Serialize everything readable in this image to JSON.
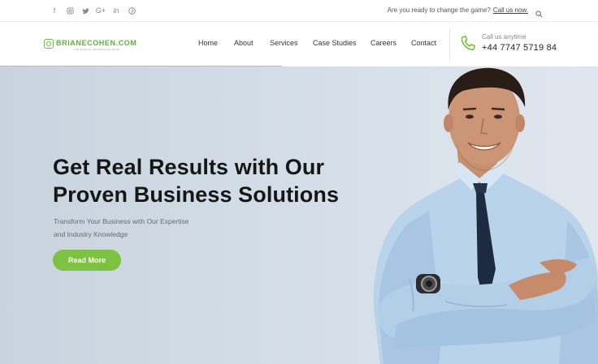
{
  "topbar": {
    "social_icons": [
      "facebook-icon",
      "instagram-icon",
      "twitter-icon",
      "google-plus-icon",
      "linkedin-icon",
      "pinterest-icon"
    ],
    "social_glyphs": [
      "f",
      "",
      "",
      "G+",
      "in",
      ""
    ],
    "promo_text": "Are you ready to change the game?",
    "promo_link": "Call us now."
  },
  "header": {
    "logo_name": "BRIANECOHEN.COM",
    "logo_tagline": "THE DIGITAL MARKETING TEAM",
    "nav": [
      "Home",
      "About",
      "Services",
      "Case Studies",
      "Careers",
      "Contact"
    ],
    "call_label": "Call us anytime",
    "call_number": "+44 7747 5719 84"
  },
  "hero": {
    "title_line1": "Get Real Results with Our",
    "title_line2": "Proven Business Solutions",
    "subtitle_line1": "Transform Your Business with Our Expertise",
    "subtitle_line2": "and Industry Knowledge",
    "cta_label": "Read More"
  },
  "colors": {
    "accent": "#7dc242",
    "logo_green": "#5db334",
    "hero_bg": "#d2dce6",
    "text_dark": "#161616"
  }
}
